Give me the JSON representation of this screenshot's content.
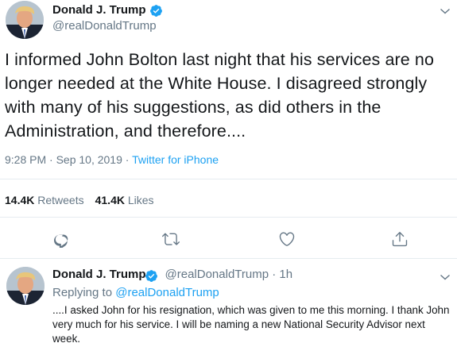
{
  "main_tweet": {
    "author": {
      "display_name": "Donald J. Trump",
      "username": "@realDonaldTrump",
      "verified": true
    },
    "text": "I informed John Bolton last night that his services are no longer needed at the White House. I disagreed strongly with many of his suggestions, as did others in the Administration, and therefore....",
    "timestamp": "9:28 PM · Sep 10, 2019",
    "separator": " · ",
    "source": "Twitter for iPhone",
    "retweets_count": "14.4K",
    "retweets_label": "Retweets",
    "likes_count": "41.4K",
    "likes_label": "Likes"
  },
  "reply_tweet": {
    "author": {
      "display_name": "Donald J. Trump",
      "username": "@realDonaldTrump",
      "verified": true
    },
    "age": "· 1h",
    "replying_to_label": "Replying to",
    "replying_to_handle": "@realDonaldTrump",
    "text": "....I asked John for his resignation, which was given to me this morning. I thank John very much for his service. I will be naming a new National Security Advisor next week."
  },
  "icons": {
    "verified": "verified-badge-icon",
    "caret": "chevron-down-icon",
    "reply": "reply-icon",
    "retweet": "retweet-icon",
    "like": "heart-icon",
    "share": "share-icon"
  },
  "colors": {
    "brand_blue": "#1da1f2",
    "secondary_text": "#657786",
    "primary_text": "#14171a",
    "divider": "#e6ecf0"
  }
}
